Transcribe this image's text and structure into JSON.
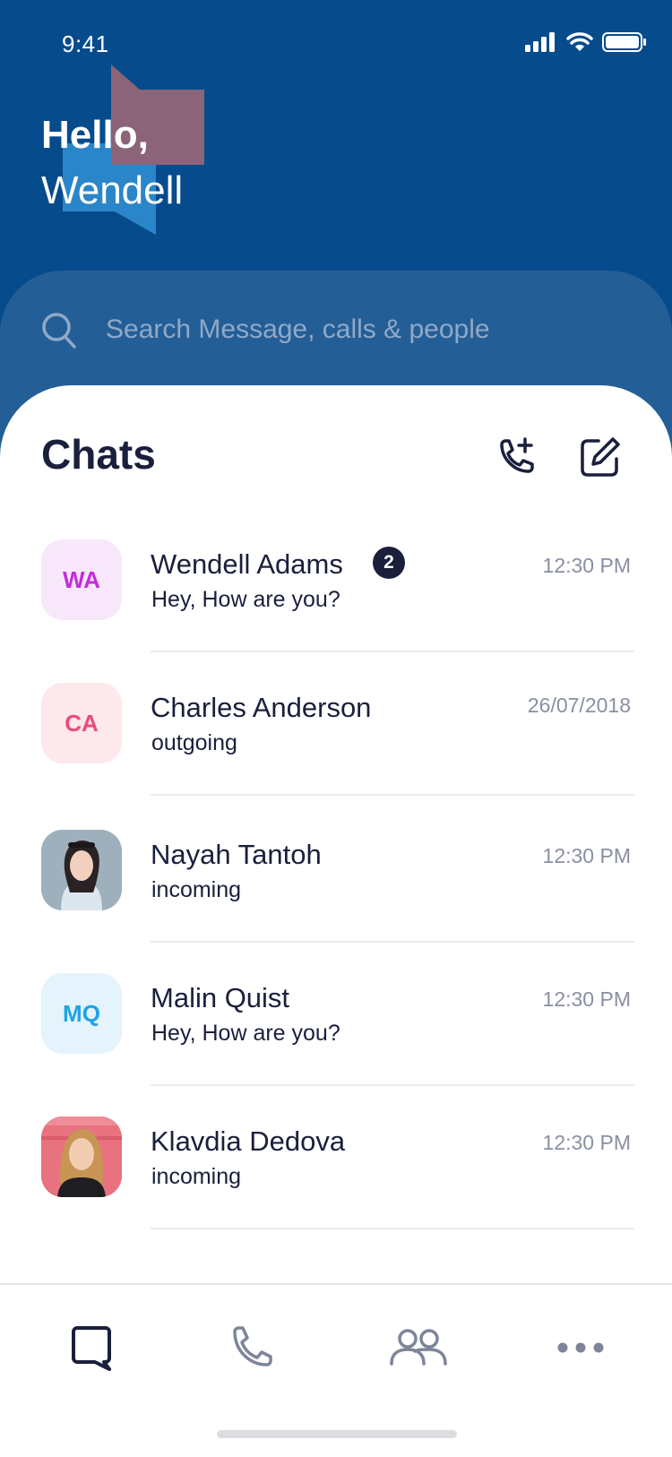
{
  "status_bar": {
    "time": "9:41"
  },
  "greeting": {
    "hello": "Hello,",
    "name": "Wendell"
  },
  "search": {
    "placeholder": "Search Message, calls & people"
  },
  "chats": {
    "title": "Chats",
    "items": [
      {
        "initials": "WA",
        "name": "Wendell Adams",
        "preview": "Hey, How are you?",
        "time": "12:30 PM",
        "unread": "2",
        "avatar_bg": "#F8E7FB",
        "avatar_fg": "#C42BDB"
      },
      {
        "initials": "CA",
        "name": "Charles Anderson",
        "preview": "outgoing",
        "time": "26/07/2018",
        "avatar_bg": "#FDE8EC",
        "avatar_fg": "#EC4B7A"
      },
      {
        "name": "Nayah Tantoh",
        "preview": "incoming",
        "time": "12:30 PM"
      },
      {
        "initials": "MQ",
        "name": "Malin Quist",
        "preview": "Hey, How are you?",
        "time": "12:30 PM",
        "avatar_bg": "#E4F3FC",
        "avatar_fg": "#1FA3E5"
      },
      {
        "name": "Klavdia Dedova",
        "preview": "incoming",
        "time": "12:30 PM"
      }
    ]
  },
  "nav": [
    "chat-icon",
    "phone-icon",
    "contacts-icon",
    "more-icon"
  ],
  "colors": {
    "header_bg": "#064B8C",
    "search_bg": "#245E96",
    "text_dark": "#1A1F3C",
    "text_muted": "#8A8FA3",
    "nav_inactive": "#7E849A"
  }
}
